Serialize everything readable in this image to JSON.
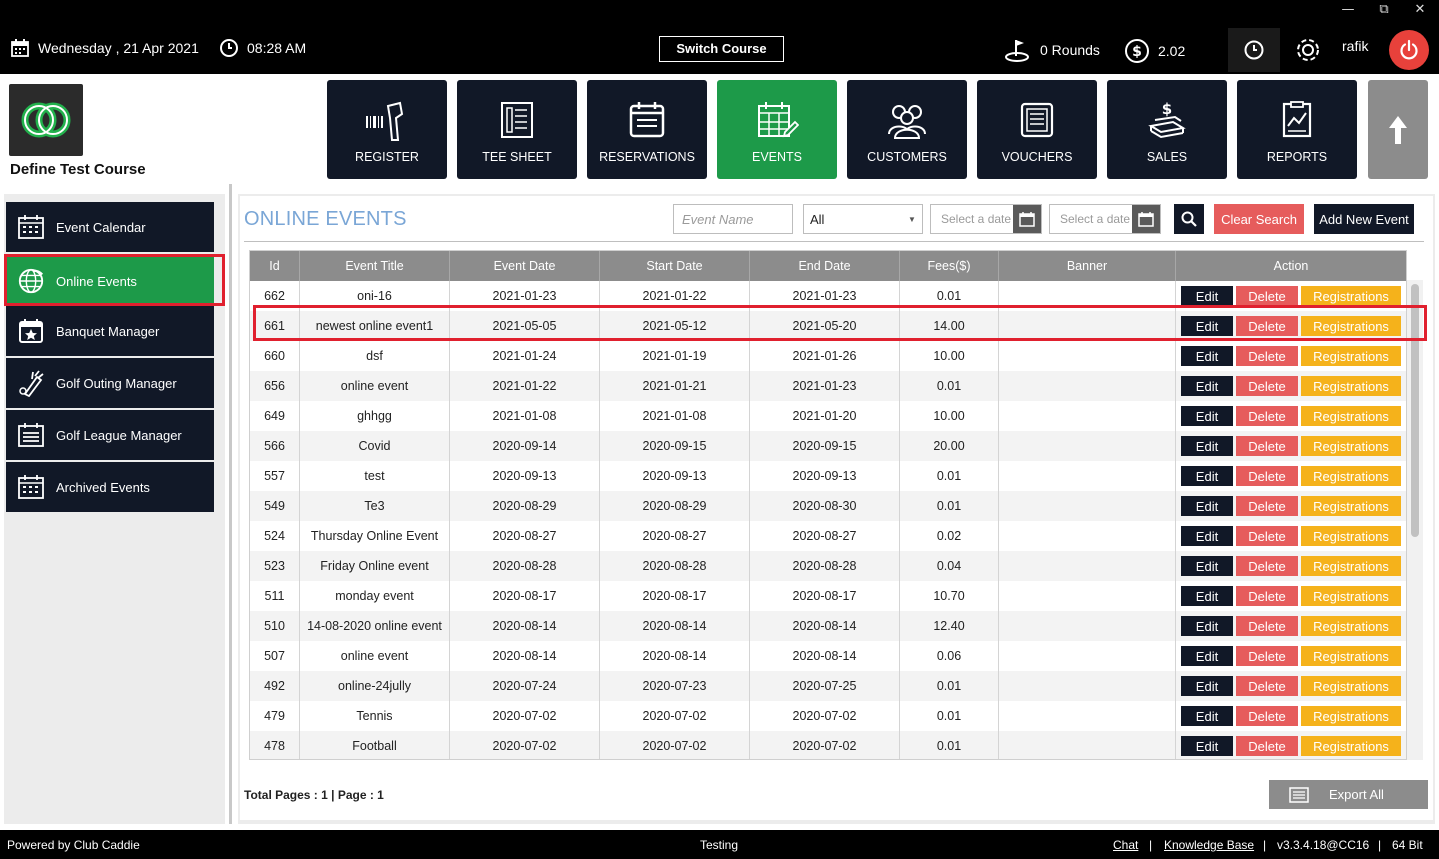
{
  "topbar": {
    "date": "Wednesday ,  21 Apr 2021",
    "time": "08:28 AM",
    "switch_course": "Switch Course",
    "rounds": "0 Rounds",
    "balance": "2.02",
    "user": "rafik",
    "window_controls": [
      "—",
      "⧉",
      "✕"
    ]
  },
  "course": {
    "name": "Define Test Course"
  },
  "nav": [
    {
      "label": "REGISTER",
      "icon": "scanner-icon"
    },
    {
      "label": "TEE SHEET",
      "icon": "tee-sheet-icon"
    },
    {
      "label": "RESERVATIONS",
      "icon": "reservations-icon"
    },
    {
      "label": "EVENTS",
      "icon": "events-icon",
      "active": true
    },
    {
      "label": "CUSTOMERS",
      "icon": "customers-icon"
    },
    {
      "label": "VOUCHERS",
      "icon": "vouchers-icon"
    },
    {
      "label": "SALES",
      "icon": "sales-icon"
    },
    {
      "label": "REPORTS",
      "icon": "reports-icon"
    }
  ],
  "sidebar": {
    "items": [
      {
        "label": "Event Calendar",
        "icon": "calendar-icon"
      },
      {
        "label": "Online Events",
        "icon": "globe-icon",
        "active": true
      },
      {
        "label": "Banquet Manager",
        "icon": "star-calendar-icon"
      },
      {
        "label": "Golf Outing Manager",
        "icon": "golf-bag-icon"
      },
      {
        "label": "Golf League Manager",
        "icon": "list-calendar-icon"
      },
      {
        "label": "Archived Events",
        "icon": "archive-calendar-icon"
      }
    ]
  },
  "main": {
    "title": "ONLINE EVENTS",
    "filters": {
      "event_name_placeholder": "Event Name",
      "status_value": "All",
      "start_date_placeholder": "Select a date",
      "end_date_placeholder": "Select a date"
    },
    "clear_search": "Clear Search",
    "add_new_event": "Add New Event",
    "columns": [
      "Id",
      "Event Title",
      "Event Date",
      "Start Date",
      "End Date",
      "Fees($)",
      "Banner",
      "Action"
    ],
    "action_labels": {
      "edit": "Edit",
      "delete": "Delete",
      "registrations": "Registrations"
    },
    "rows": [
      [
        "662",
        "oni-16",
        "2021-01-23",
        "2021-01-22",
        "2021-01-23",
        "0.01"
      ],
      [
        "661",
        "newest online event1",
        "2021-05-05",
        "2021-05-12",
        "2021-05-20",
        "14.00"
      ],
      [
        "660",
        "dsf",
        "2021-01-24",
        "2021-01-19",
        "2021-01-26",
        "10.00"
      ],
      [
        "656",
        "online event",
        "2021-01-22",
        "2021-01-21",
        "2021-01-23",
        "0.01"
      ],
      [
        "649",
        "ghhgg",
        "2021-01-08",
        "2021-01-08",
        "2021-01-20",
        "10.00"
      ],
      [
        "566",
        "Covid",
        "2020-09-14",
        "2020-09-15",
        "2020-09-15",
        "20.00"
      ],
      [
        "557",
        "test",
        "2020-09-13",
        "2020-09-13",
        "2020-09-13",
        "0.01"
      ],
      [
        "549",
        "Te3",
        "2020-08-29",
        "2020-08-29",
        "2020-08-30",
        "0.01"
      ],
      [
        "524",
        "Thursday Online Event",
        "2020-08-27",
        "2020-08-27",
        "2020-08-27",
        "0.02"
      ],
      [
        "523",
        "Friday Online event",
        "2020-08-28",
        "2020-08-28",
        "2020-08-28",
        "0.04"
      ],
      [
        "511",
        "monday event",
        "2020-08-17",
        "2020-08-17",
        "2020-08-17",
        "10.70"
      ],
      [
        "510",
        "14-08-2020 online event",
        "2020-08-14",
        "2020-08-14",
        "2020-08-14",
        "12.40"
      ],
      [
        "507",
        "online event",
        "2020-08-14",
        "2020-08-14",
        "2020-08-14",
        "0.06"
      ],
      [
        "492",
        "online-24jully",
        "2020-07-24",
        "2020-07-23",
        "2020-07-25",
        "0.01"
      ],
      [
        "479",
        "Tennis",
        "2020-07-02",
        "2020-07-02",
        "2020-07-02",
        "0.01"
      ],
      [
        "478",
        "Football",
        "2020-07-02",
        "2020-07-02",
        "2020-07-02",
        "0.01"
      ]
    ],
    "highlighted_row_id": "661",
    "pagination": "Total Pages : 1 | Page : 1",
    "export_all": "Export All"
  },
  "footer": {
    "powered_by": "Powered by Club Caddie",
    "environment": "Testing",
    "chat": "Chat",
    "sep1": "|",
    "knowledge_base": "Knowledge Base",
    "sep2": "|",
    "version": "v3.3.4.18@CC16",
    "sep3": "|",
    "bitness": "64 Bit"
  },
  "colors": {
    "brand_dark": "#111827",
    "active_green": "#1d9a49",
    "delete_red": "#e65c5c",
    "registrations_yellow": "#f5b21b",
    "title_blue": "#7aa6d6",
    "highlight_red": "#e0202e"
  }
}
